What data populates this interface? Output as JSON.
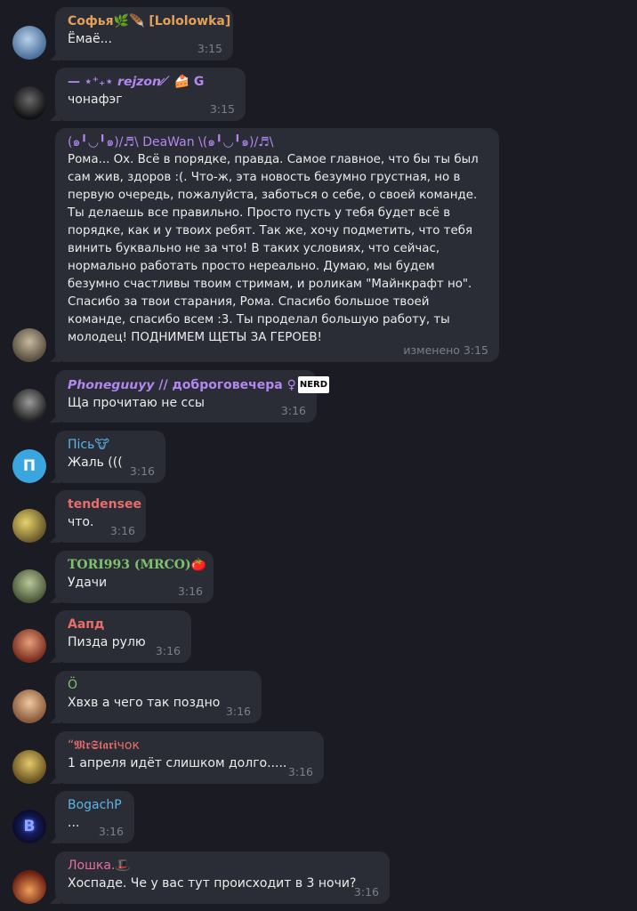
{
  "messages": [
    {
      "sender": "Софья🌿🪶 [Lololowka]",
      "text": "Ёмаё...",
      "time": "3:15",
      "color": "#e2a15a"
    },
    {
      "sender": "— ⋆⁺₊⋆ 𝙧𝙚𝙟𝙯𝙤𝙣 ̷ ̸ 🍰 G",
      "text": "чонафэг",
      "time": "3:15",
      "color": "#b287f0"
    },
    {
      "sender": "(๑╹◡╹๑)/♬\\ DeaWan \\(๑╹◡╹๑)/♬\\",
      "text": "Рома... Ох. Всё в порядке, правда. Самое главное, что бы ты был сам жив, здоров :(. Что-ж, эта новость безумно грустная, но в первую очередь, пожалуйста, заботься о себе, о своей команде. Ты делаешь все правильно. Просто пусть у тебя будет всё в порядке, как и у твоих ребят. Так же, хочу подметить, что тебя винить буквально не за что! В таких условиях, что сейчас, нормально работать просто нереально. Думаю, мы будем безумно счастливы твоим стримам, и роликам \"Майнкрафт но\". Спасибо за твои старания, Рома. Спасибо большое твоей команде, спасибо всем :3. Ты проделал большую работу, ты молодец! ПОДНИМЕМ ЩЕТЫ ЗА ГЕРОЕВ!",
      "time": "изменено 3:15",
      "color": "#b287f0"
    },
    {
      "sender": "𝙋𝙝𝙤𝙣𝙚𝙜𝙪𝙪𝙮𝙮 // доброговечера ♀",
      "badge": "NERD",
      "text": "Ща прочитаю не ссы",
      "time": "3:16",
      "color": "#b287f0"
    },
    {
      "sender": "Пісь🐮",
      "text": "Жаль (((",
      "time": "3:16",
      "color": "#5bb5e6"
    },
    {
      "sender": "tendensee",
      "text": "что.",
      "time": "3:16",
      "color": "#e86d6d"
    },
    {
      "sender": "TORI993 (MRCO)🍅",
      "text": "Удачи",
      "time": "3:16",
      "color": "#7ec36a"
    },
    {
      "sender": "Аапд",
      "text": "Пизда рулю",
      "time": "3:16",
      "color": "#e86d6d"
    },
    {
      "sender": "Ö",
      "text": "Хвхв а чего так поздно",
      "time": "3:16",
      "color": "#7ec36a"
    },
    {
      "sender": "“𝕸𝖗𝕾𝖙𝖆𝖗𝖎чок",
      "text": "1 апреля идёт слишком долго.....",
      "time": "3:16",
      "color": "#e86d6d"
    },
    {
      "sender": "BogachP",
      "text": "...",
      "time": "3:16",
      "color": "#5bb5e6"
    },
    {
      "sender": "Лошка.🎩",
      "text": "Хоспаде. Че у вас тут происходит в 3 ночи?",
      "time": "3:16",
      "color": "#e86d9a"
    }
  ],
  "avatars": [
    {
      "icon": "avatar-anime-girl",
      "color": "#6f8fb0"
    },
    {
      "icon": "avatar-dark-figure",
      "color": "#3a3a3a"
    },
    {
      "icon": "avatar-character",
      "color": "#8a7d6a"
    },
    {
      "icon": "avatar-portrait",
      "color": "#4a4a4a"
    },
    {
      "icon": "avatar-letter-p",
      "letter": "П",
      "color": "#3ba5e0"
    },
    {
      "icon": "avatar-sponge",
      "color": "#c9b04a"
    },
    {
      "icon": "avatar-landscape",
      "color": "#8a9a6a"
    },
    {
      "icon": "avatar-person-red",
      "color": "#b8563f"
    },
    {
      "icon": "avatar-smiling-person",
      "color": "#d9a37a"
    },
    {
      "icon": "avatar-yellow-character",
      "color": "#b89a3a"
    },
    {
      "icon": "avatar-letter-b-neon",
      "letter": "B",
      "color": "#1a1f5a"
    },
    {
      "icon": "avatar-sunset",
      "color": "#c4552e"
    }
  ]
}
